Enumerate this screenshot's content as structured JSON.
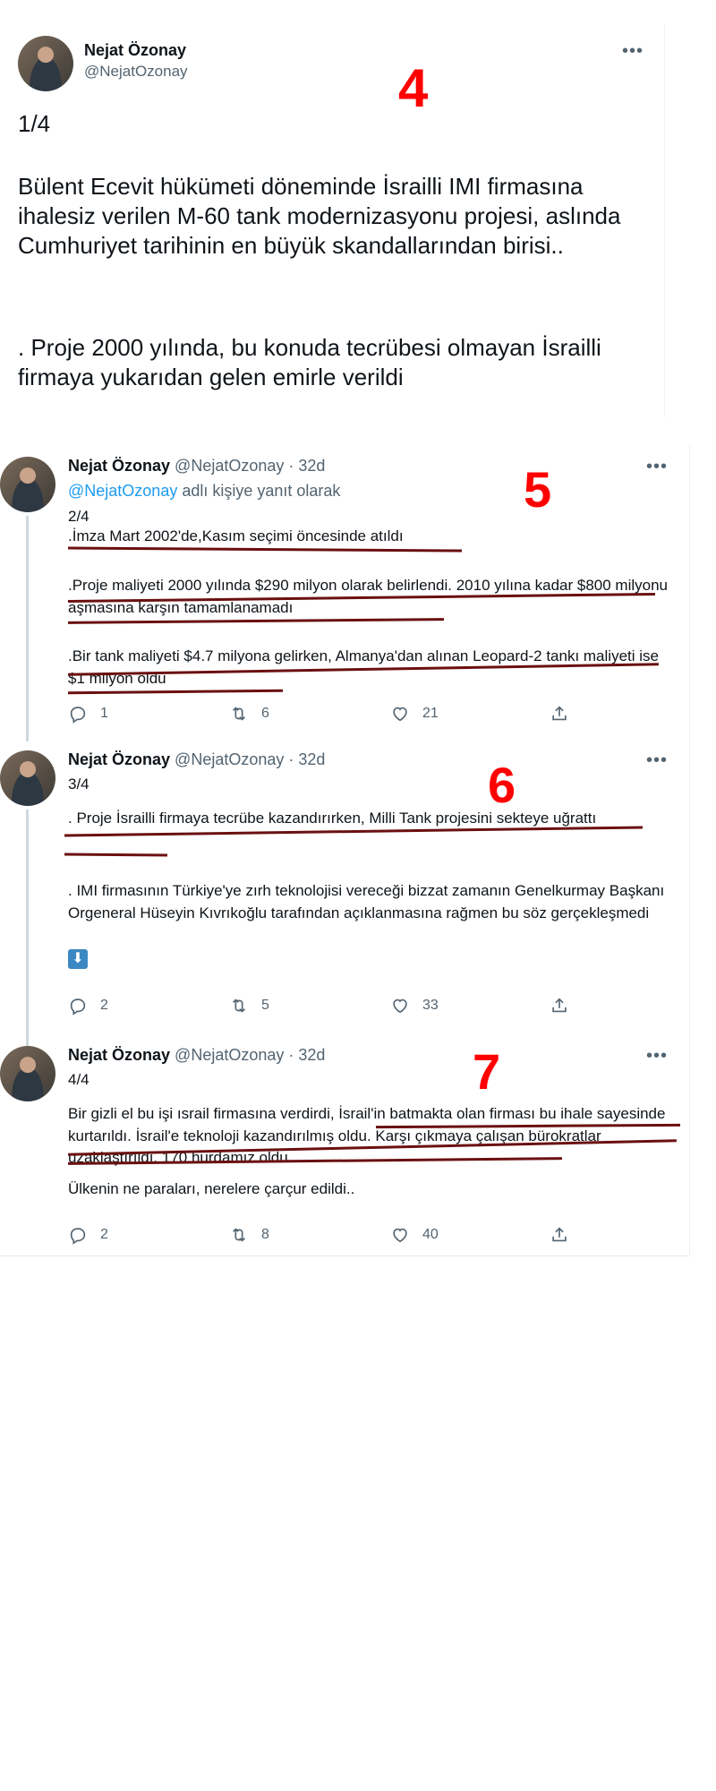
{
  "main_tweet": {
    "author_name": "Nejat Özonay",
    "handle": "@NejatOzonay",
    "counter": "1/4",
    "paragraph1": "Bülent Ecevit hükümeti döneminde İsrailli IMI firmasına ihalesiz verilen M-60 tank modernizasyonu projesi, aslında Cumhuriyet tarihinin en büyük skandallarından birisi..",
    "paragraph2": ". Proje 2000 yılında, bu konuda tecrübesi olmayan İsrailli firmaya yukarıdan gelen emirle verildi",
    "annotation": "4"
  },
  "replies": [
    {
      "author_name": "Nejat Özonay",
      "handle_time": "@NejatOzonay · 32d",
      "replying_link": "@NejatOzonay",
      "replying_text": " adlı kişiye yanıt olarak",
      "counter": "2/4",
      "paragraphs": [
        ".İmza Mart 2002'de,Kasım seçimi öncesinde atıldı",
        ".Proje maliyeti 2000 yılında $290 milyon olarak belirlendi. 2010 yılına kadar $800 milyonu aşmasına karşın tamamlanamadı",
        ".Bir tank maliyeti $4.7 milyona gelirken, Almanya'dan alınan Leopard-2 tankı maliyeti ise $1 milyon oldu"
      ],
      "replies_count": "1",
      "retweets_count": "6",
      "likes_count": "21",
      "annotation": "5"
    },
    {
      "author_name": "Nejat Özonay",
      "handle_time": "@NejatOzonay · 32d",
      "counter": "3/4",
      "paragraphs": [
        ". Proje İsrailli firmaya tecrübe kazandırırken, Milli Tank projesini sekteye uğrattı",
        ". IMI firmasının Türkiye'ye zırh teknolojisi vereceği bizzat zamanın Genelkurmay Başkanı Orgeneral Hüseyin Kıvrıkoğlu tarafından açıklanmasına rağmen bu söz gerçekleşmedi",
        "⬇"
      ],
      "replies_count": "2",
      "retweets_count": "5",
      "likes_count": "33",
      "annotation": "6"
    },
    {
      "author_name": "Nejat Özonay",
      "handle_time": "@NejatOzonay · 32d",
      "counter": "4/4",
      "paragraphs": [
        "Bir gizli el bu işi ısrail firmasına verdirdi, İsrail'in batmakta olan firması bu ihale sayesinde kurtarıldı. İsrail'e teknoloji kazandırılmış oldu. Karşı çıkmaya çalışan bürokratlar uzaklaştırıldı. 170 hurdamız oldu..",
        "Ülkenin ne paraları, nerelere çarçur edildi.."
      ],
      "replies_count": "2",
      "retweets_count": "8",
      "likes_count": "40",
      "annotation": "7"
    }
  ],
  "icons": {
    "more": "more-icon",
    "reply": "reply-icon",
    "retweet": "retweet-icon",
    "like": "like-icon",
    "share": "share-icon",
    "emoji": "down-arrow-emoji"
  },
  "colors": {
    "annotation": "#ff0000",
    "underline": "#6b1010",
    "link": "#1d9bf0",
    "muted": "#536471"
  }
}
